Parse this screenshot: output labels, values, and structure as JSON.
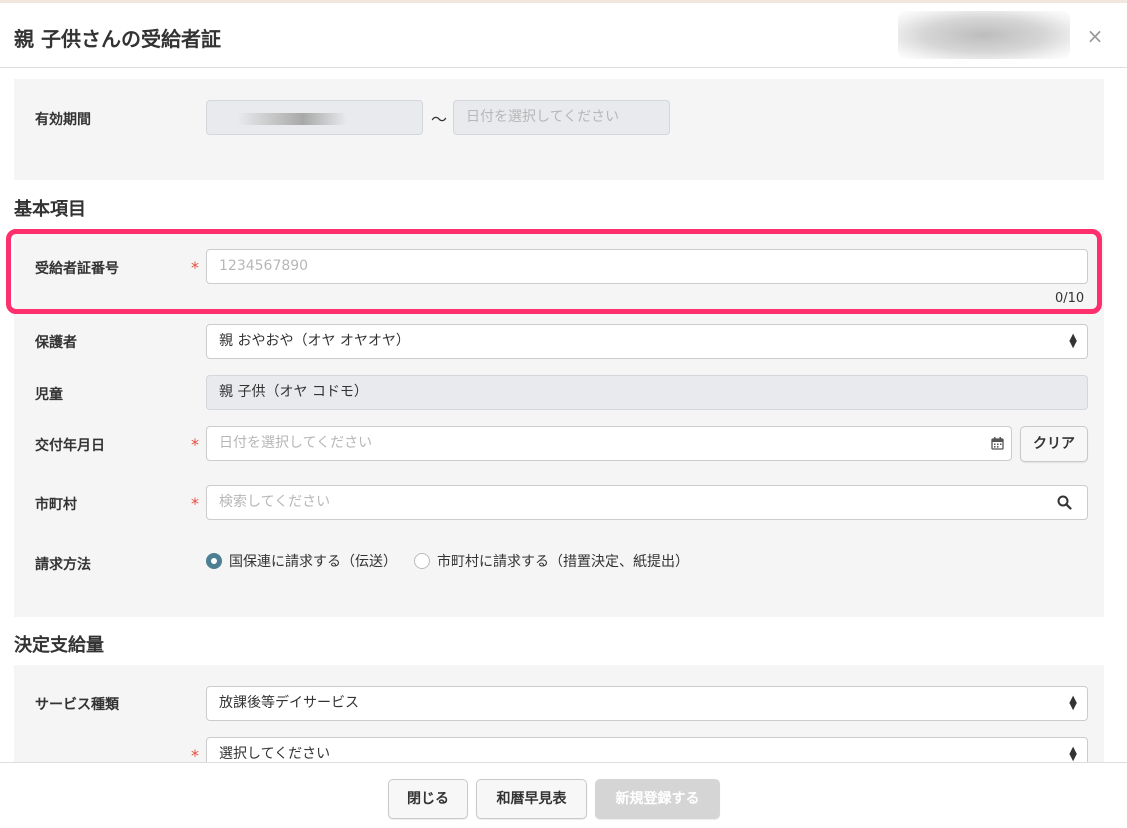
{
  "header": {
    "title": "親 子供さんの受給者証",
    "close_symbol": "×"
  },
  "validity": {
    "label": "有効期間",
    "separator": "〜",
    "end_placeholder": "日付を選択してください"
  },
  "basic": {
    "section_title": "基本項目",
    "certificate_number": {
      "label": "受給者証番号",
      "required_mark": "*",
      "placeholder": "1234567890",
      "counter": "0/10"
    },
    "guardian": {
      "label": "保護者",
      "value": "親 おやおや（オヤ オヤオヤ）"
    },
    "child": {
      "label": "児童",
      "value": "親 子供（オヤ コドモ）"
    },
    "issue_date": {
      "label": "交付年月日",
      "required_mark": "*",
      "placeholder": "日付を選択してください",
      "clear_label": "クリア"
    },
    "municipality": {
      "label": "市町村",
      "required_mark": "*",
      "placeholder": "検索してください"
    },
    "billing": {
      "label": "請求方法",
      "options": [
        {
          "label": "国保連に請求する（伝送）",
          "selected": true
        },
        {
          "label": "市町村に請求する（措置決定、紙提出）",
          "selected": false
        }
      ]
    }
  },
  "supply": {
    "section_title": "決定支給量",
    "service_type": {
      "label": "サービス種類",
      "value": "放課後等デイサービス"
    },
    "second_select": {
      "required_mark": "*",
      "value": "選択してください"
    }
  },
  "footer": {
    "close_label": "閉じる",
    "calendar_label": "和暦早見表",
    "register_label": "新規登録する"
  },
  "colors": {
    "highlight": "#ff2e6d",
    "required": "#e74c3c",
    "radio_checked": "#4c7f92"
  }
}
